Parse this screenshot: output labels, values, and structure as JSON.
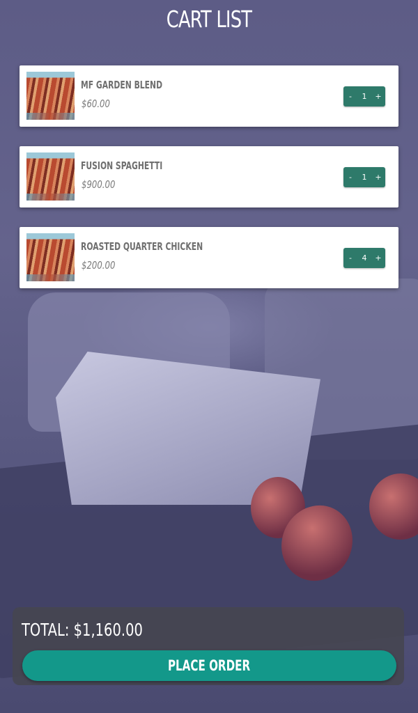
{
  "page": {
    "title": "CART LIST"
  },
  "cart": {
    "items": [
      {
        "name": "MF GARDEN BLEND",
        "price": "$60.00",
        "qty": "1",
        "minus": "-",
        "plus": "+"
      },
      {
        "name": "FUSION SPAGHETTI",
        "price": "$900.00",
        "qty": "1",
        "minus": "-",
        "plus": "+"
      },
      {
        "name": "ROASTED QUARTER CHICKEN",
        "price": "$200.00",
        "qty": "4",
        "minus": "-",
        "plus": "+"
      }
    ]
  },
  "footer": {
    "total_label": "TOTAL:",
    "total_value": "$1,160.00",
    "order_button": "PLACE ORDER"
  },
  "colors": {
    "stepper": "#2e7a6a",
    "order_button": "#13988a",
    "footer_panel": "#46464f"
  }
}
